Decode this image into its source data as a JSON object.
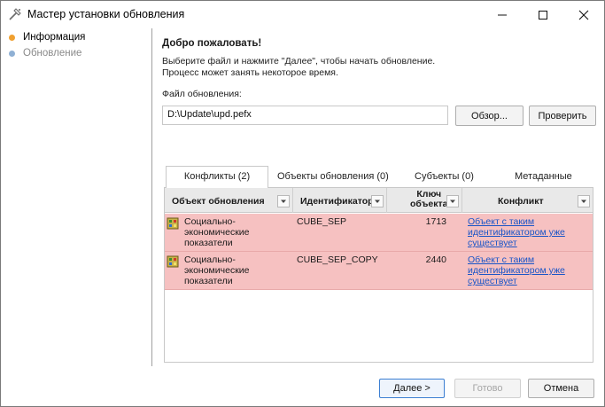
{
  "window": {
    "title": "Мастер установки обновления",
    "icon": "wizard-wand-icon"
  },
  "sidebar": {
    "steps": [
      {
        "label": "Информация",
        "state": "current",
        "color": "#f0a030"
      },
      {
        "label": "Обновление",
        "state": "pending",
        "color": "#8fb0d4"
      }
    ]
  },
  "main": {
    "welcome": "Добро пожаловать!",
    "desc_line1": "Выберите файл и нажмите \"Далее\", чтобы начать обновление.",
    "desc_line2": "Процесс может занять некоторое время.",
    "file_label": "Файл обновления:",
    "file_value": "D:\\Update\\upd.pefx",
    "browse_label": "Обзор...",
    "check_label": "Проверить",
    "tabs": [
      {
        "label": "Конфликты (2)",
        "active": true
      },
      {
        "label": "Объекты обновления (0)",
        "active": false
      },
      {
        "label": "Субъекты (0)",
        "active": false
      },
      {
        "label": "Метаданные",
        "active": false
      }
    ],
    "grid": {
      "columns": [
        "Объект обновления",
        "Идентификатор",
        "Ключ объекта",
        "Конфликт"
      ],
      "key_col_line1": "Ключ",
      "key_col_line2": "объекта",
      "rows": [
        {
          "object_line1": "Социально-",
          "object_line2": "экономические",
          "object_line3": "показатели",
          "id": "CUBE_SEP",
          "key": "1713",
          "conflict_line1": "Объект с таким",
          "conflict_line2": "идентификатором уже",
          "conflict_line3": "существует"
        },
        {
          "object_line1": "Социально-",
          "object_line2": "экономические",
          "object_line3": "показатели",
          "id": "CUBE_SEP_COPY",
          "key": "2440",
          "conflict_line1": "Объект с таким",
          "conflict_line2": "идентификатором уже",
          "conflict_line3": "существует"
        }
      ],
      "row_color": "#f6c1c1"
    }
  },
  "footer": {
    "next_label": "Далее >",
    "done_label": "Готово",
    "cancel_label": "Отмена"
  }
}
